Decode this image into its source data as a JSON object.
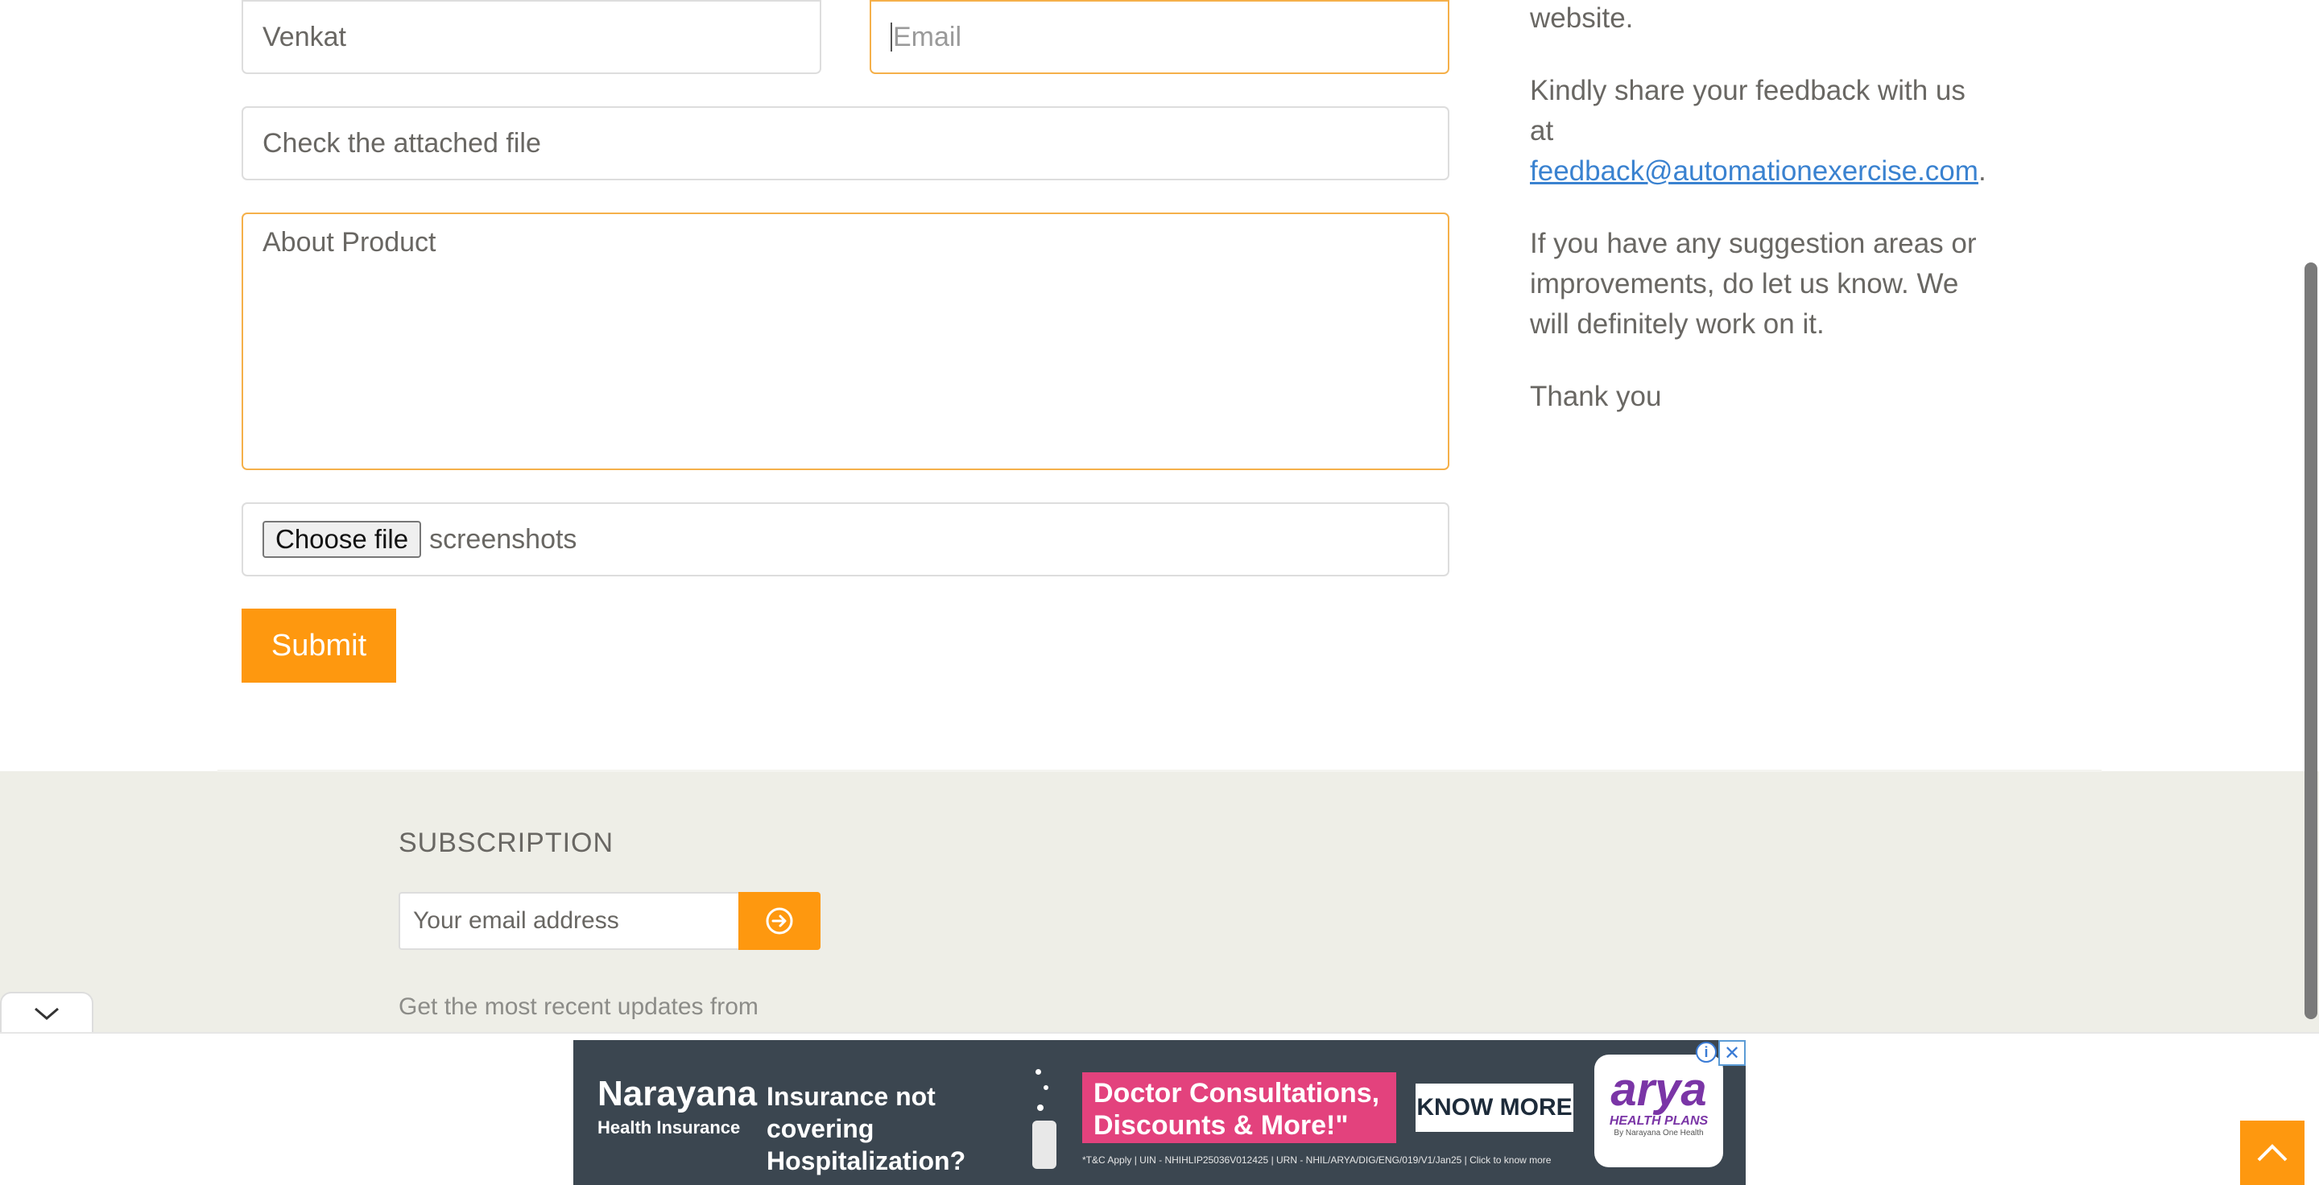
{
  "form": {
    "name_value": "Venkat",
    "email_placeholder": "Email",
    "subject_value": "Check the attached file",
    "message_value": "About Product",
    "choose_file_label": "Choose file",
    "file_name": "screenshots",
    "submit_label": "Submit"
  },
  "info": {
    "line_top": "website.",
    "feedback_prefix": "Kindly share your feedback with us at",
    "feedback_email": "feedback@automationexercise.com",
    "feedback_suffix": ".",
    "suggestion": "If you have any suggestion areas or improvements, do let us know. We will definitely work on it.",
    "thanks": "Thank you"
  },
  "footer": {
    "subscription_title": "SUBSCRIPTION",
    "email_placeholder": "Your email address",
    "submit_icon": "arrow-circle-right-icon",
    "description": "Get the most recent updates from"
  },
  "ad": {
    "brand_name": "Narayana",
    "brand_sub": "Health Insurance",
    "headline": "Insurance not covering Hospitalization?",
    "offer": "Doctor Consultations, Discounts & More!\"",
    "cta": "KNOW MORE",
    "fine_print": "*T&C Apply | UIN - NHIHLIP25036V012425 | URN - NHIL/ARYA/DIG/ENG/019/V1/Jan25 | Click to know more",
    "arya_name": "arya",
    "arya_tag": "HEALTH PLANS",
    "arya_byline": "By Narayana One Health",
    "info_icon": "info-icon",
    "close_icon": "close-icon"
  },
  "colors": {
    "accent": "#fe980f",
    "link": "#3a82d0",
    "footer_bg": "#eeeee7",
    "ad_bg": "#3b4650",
    "ad_pink": "#e3427d"
  }
}
